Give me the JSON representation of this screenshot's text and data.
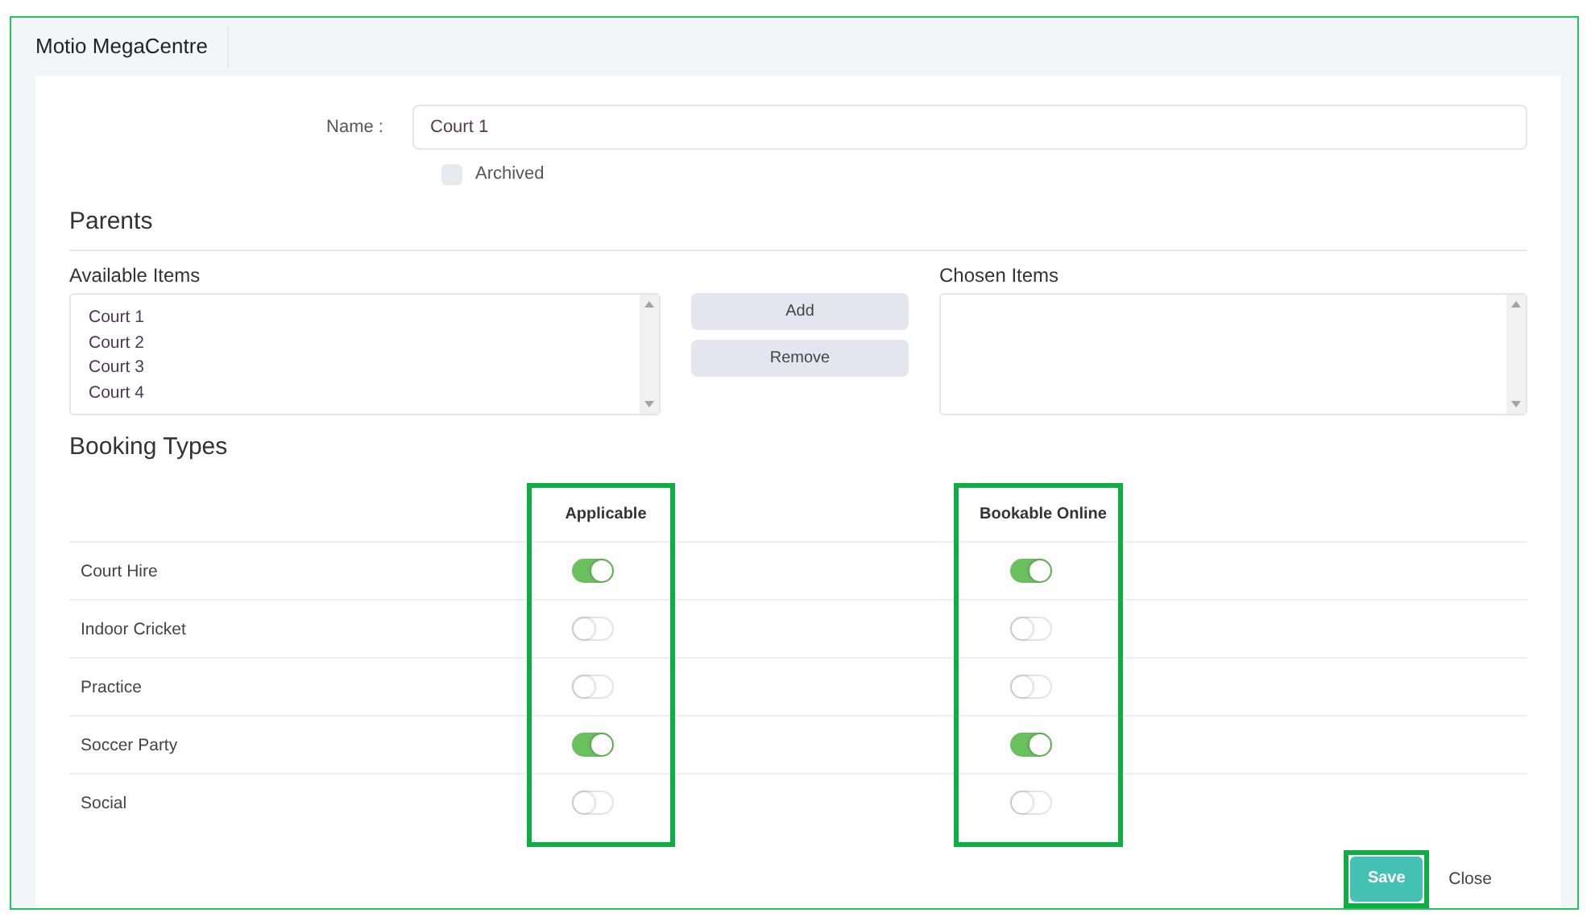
{
  "tab": {
    "label": "Motio MegaCentre"
  },
  "name_field": {
    "label": "Name :",
    "value": "Court 1"
  },
  "archived": {
    "label": "Archived",
    "checked": false
  },
  "parents": {
    "heading": "Parents",
    "available": {
      "label": "Available Items",
      "items": [
        "Court 1",
        "Court 2",
        "Court 3",
        "Court 4"
      ]
    },
    "buttons": [
      "Add",
      "Remove"
    ],
    "chosen": {
      "label": "Chosen Items"
    }
  },
  "booking_types": {
    "heading": "Booking Types",
    "columns": [
      {
        "label": "Applicable",
        "highlighted": true
      },
      {
        "label": "Bookable Online",
        "highlighted": true
      }
    ],
    "rows": [
      {
        "name": "Court Hire",
        "values": [
          true,
          true
        ]
      },
      {
        "name": "Indoor Cricket",
        "values": [
          false,
          false
        ]
      },
      {
        "name": "Practice",
        "values": [
          false,
          false
        ]
      },
      {
        "name": "Soccer Party",
        "values": [
          true,
          true
        ]
      },
      {
        "name": "Social",
        "values": [
          false,
          false
        ]
      }
    ]
  },
  "footer": {
    "buttons": [
      {
        "label": "Save",
        "kind": "primary",
        "highlighted": true
      },
      {
        "label": "Close",
        "kind": "link",
        "highlighted": false
      }
    ]
  }
}
